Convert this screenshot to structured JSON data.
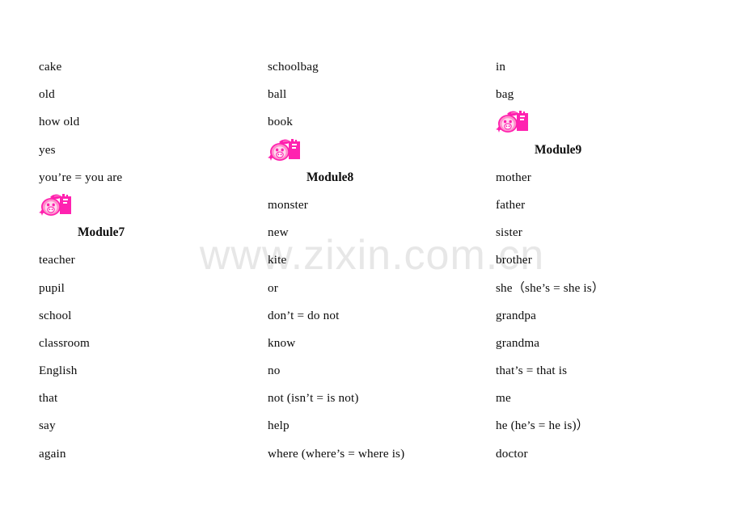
{
  "document": {
    "title": "Vocabulary word list — Modules 7, 8, 9",
    "watermark": "www.zixin.com.cn",
    "background_color": "#ffffff",
    "text_color": "#0c0c0c",
    "watermark_color": "#e7e7e7",
    "icon_colors": {
      "body": "#ff8ecb",
      "outline": "#ff1fae",
      "block": "#ff22b0",
      "face": "#ffd9ee",
      "white": "#ffffff"
    }
  },
  "columns": [
    {
      "name": "column-1",
      "items": [
        {
          "type": "word",
          "text": "cake"
        },
        {
          "type": "word",
          "text": "old"
        },
        {
          "type": "word",
          "text": "how old"
        },
        {
          "type": "word",
          "text": "yes"
        },
        {
          "type": "word",
          "text": "you’re = you are"
        },
        {
          "type": "module",
          "icon": "pig-apple-icon",
          "title": "Module7"
        },
        {
          "type": "word",
          "text": "teacher"
        },
        {
          "type": "word",
          "text": "pupil"
        },
        {
          "type": "word",
          "text": "school"
        },
        {
          "type": "word",
          "text": "classroom"
        },
        {
          "type": "word",
          "text": "English"
        },
        {
          "type": "word",
          "text": "that"
        },
        {
          "type": "word",
          "text": "say"
        },
        {
          "type": "word",
          "text": "again"
        }
      ]
    },
    {
      "name": "column-2",
      "items": [
        {
          "type": "word",
          "text": "schoolbag"
        },
        {
          "type": "word",
          "text": "ball"
        },
        {
          "type": "word",
          "text": "book"
        },
        {
          "type": "module",
          "icon": "pig-apple-icon",
          "title": "Module8"
        },
        {
          "type": "word",
          "text": "monster"
        },
        {
          "type": "word",
          "text": "new"
        },
        {
          "type": "word",
          "text": "kite"
        },
        {
          "type": "word",
          "text": "or"
        },
        {
          "type": "word",
          "text": "don’t = do not"
        },
        {
          "type": "word",
          "text": "know"
        },
        {
          "type": "word",
          "text": "no"
        },
        {
          "type": "word",
          "text": "not (isn’t = is not)"
        },
        {
          "type": "word",
          "text": "help"
        },
        {
          "type": "word",
          "text": "where (where’s = where is)"
        }
      ]
    },
    {
      "name": "column-3",
      "items": [
        {
          "type": "word",
          "text": "in"
        },
        {
          "type": "word",
          "text": "bag"
        },
        {
          "type": "module",
          "icon": "pig-apple-icon",
          "title": "Module9"
        },
        {
          "type": "word",
          "text": "mother"
        },
        {
          "type": "word",
          "text": "father"
        },
        {
          "type": "word",
          "text": "sister"
        },
        {
          "type": "word",
          "text": "brother"
        },
        {
          "type": "word",
          "text": "she（she’s = she is）"
        },
        {
          "type": "word",
          "text": "grandpa"
        },
        {
          "type": "word",
          "text": "grandma"
        },
        {
          "type": "word",
          "text": "that’s = that is"
        },
        {
          "type": "word",
          "text": "me"
        },
        {
          "type": "word",
          "text": "he (he’s = he is)）"
        },
        {
          "type": "word",
          "text": "doctor"
        }
      ]
    }
  ]
}
